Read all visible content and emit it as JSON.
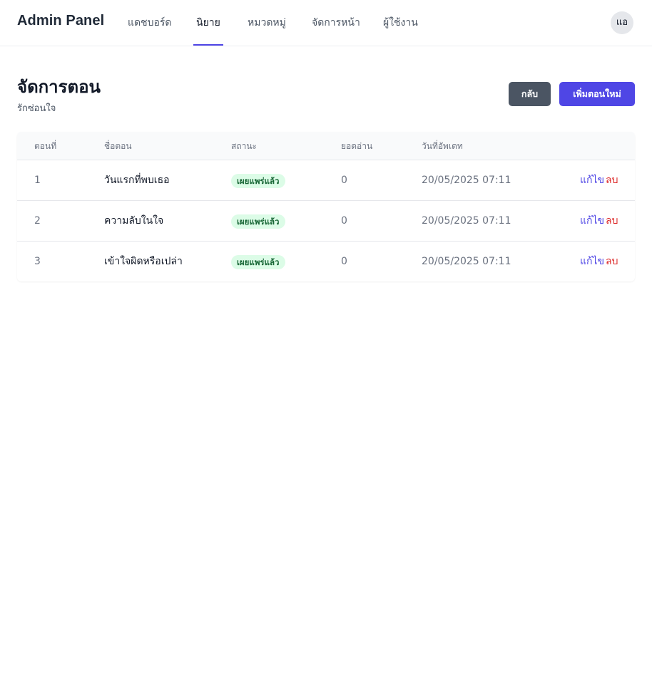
{
  "header": {
    "brand": "Admin Panel",
    "nav": [
      {
        "label": "แดชบอร์ด",
        "active": false
      },
      {
        "label": "นิยาย",
        "active": true
      },
      {
        "label": "หมวดหมู่",
        "active": false
      },
      {
        "label": "จัดการหน้า",
        "active": false
      },
      {
        "label": "ผู้ใช้งาน",
        "active": false
      }
    ],
    "avatar_initials": "แอ"
  },
  "page": {
    "title": "จัดการตอน",
    "subtitle": "รักซ่อนใจ",
    "back_label": "กลับ",
    "add_label": "เพิ่มตอนใหม่"
  },
  "table": {
    "columns": [
      "ตอนที่",
      "ชื่อตอน",
      "สถานะ",
      "ยอดอ่าน",
      "วันที่อัพเดท"
    ],
    "rows": [
      {
        "number": "1",
        "title": "วันแรกที่พบเธอ",
        "status": "เผยแพร่แล้ว",
        "reads": "0",
        "updated": "20/05/2025 07:11",
        "edit": "แก้ไข",
        "delete": "ลบ"
      },
      {
        "number": "2",
        "title": "ความลับในใจ",
        "status": "เผยแพร่แล้ว",
        "reads": "0",
        "updated": "20/05/2025 07:11",
        "edit": "แก้ไข",
        "delete": "ลบ"
      },
      {
        "number": "3",
        "title": "เข้าใจผิดหรือเปล่า",
        "status": "เผยแพร่แล้ว",
        "reads": "0",
        "updated": "20/05/2025 07:11",
        "edit": "แก้ไข",
        "delete": "ลบ"
      }
    ]
  },
  "colors": {
    "accent": "#4f46e5",
    "secondary_button": "#4b5563",
    "badge_bg": "#dcfce7",
    "badge_text": "#166534",
    "delete": "#dc2626"
  }
}
